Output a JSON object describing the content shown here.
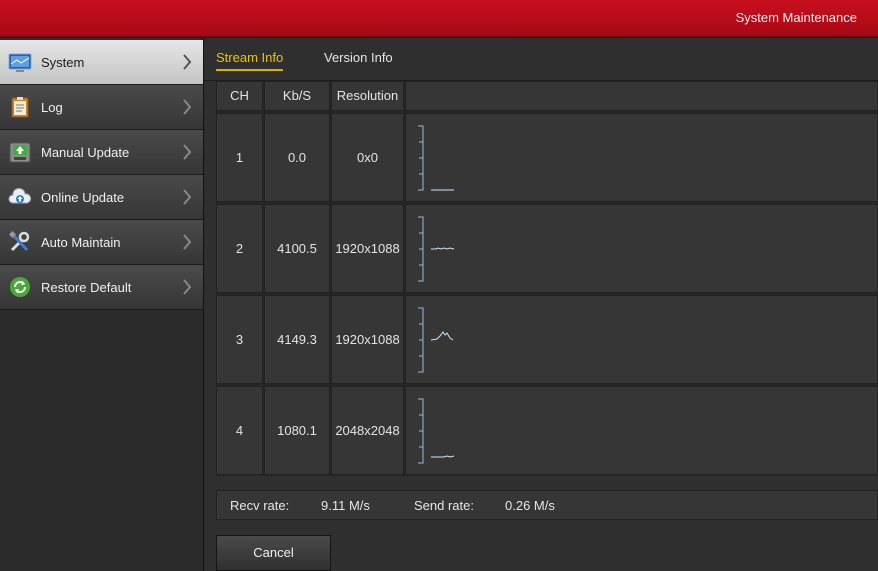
{
  "header": {
    "title": "System Maintenance"
  },
  "sidebar": {
    "items": [
      {
        "label": "System",
        "icon": "monitor-icon",
        "active": true
      },
      {
        "label": "Log",
        "icon": "clipboard-icon"
      },
      {
        "label": "Manual Update",
        "icon": "upload-disk-icon"
      },
      {
        "label": "Online Update",
        "icon": "cloud-upload-icon"
      },
      {
        "label": "Auto Maintain",
        "icon": "tools-icon"
      },
      {
        "label": "Restore Default",
        "icon": "refresh-icon"
      }
    ]
  },
  "tabs": [
    {
      "label": "Stream Info",
      "active": true
    },
    {
      "label": "Version Info"
    }
  ],
  "table": {
    "headers": [
      "CH",
      "Kb/S",
      "Resolution",
      ""
    ],
    "rows": [
      {
        "ch": "1",
        "kbs": "0.0",
        "resolution": "0x0"
      },
      {
        "ch": "2",
        "kbs": "4100.5",
        "resolution": "1920x1088"
      },
      {
        "ch": "3",
        "kbs": "4149.3",
        "resolution": "1920x1088"
      },
      {
        "ch": "4",
        "kbs": "1080.1",
        "resolution": "2048x2048"
      }
    ]
  },
  "rates": {
    "recv_label": "Recv rate:",
    "recv_value": "9.11 M/s",
    "send_label": "Send rate:",
    "send_value": "0.26 M/s"
  },
  "buttons": {
    "cancel": "Cancel"
  },
  "colors": {
    "header_red": "#b80c18",
    "accent_yellow": "#e8c600",
    "graph_line": "#9db8d6"
  }
}
